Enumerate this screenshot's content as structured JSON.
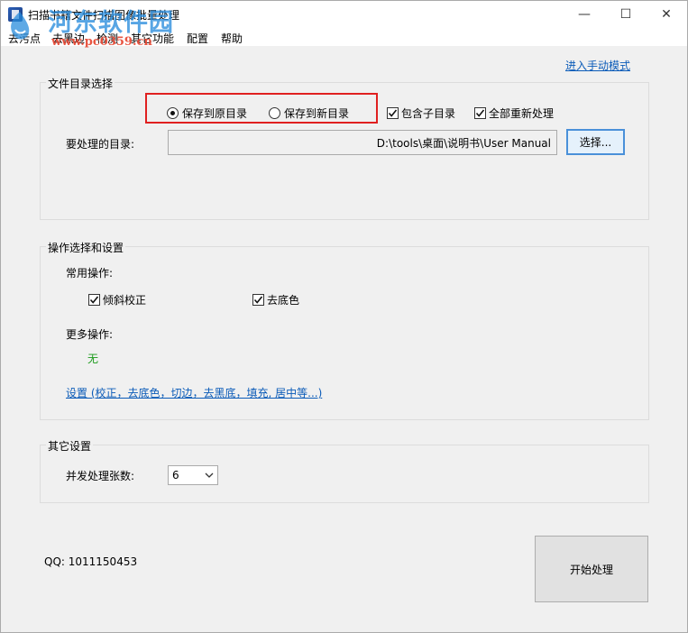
{
  "window": {
    "title": "扫描书籍文件扫描图像批量处理",
    "controls": {
      "minimize": "—",
      "maximize": "☐",
      "close": "✕"
    }
  },
  "watermark": {
    "site_name": "河东软件园",
    "url": "www.pc0359.cn"
  },
  "menu": {
    "items": [
      "去污点",
      "去黑边",
      "检测",
      "其它功能",
      "配置",
      "帮助"
    ]
  },
  "manual_mode_link": "进入手动模式",
  "file_group": {
    "title": "文件目录选择",
    "radio_original": "保存到原目录",
    "radio_new": "保存到新目录",
    "selected": "original",
    "include_subdirs": {
      "label": "包含子目录",
      "checked": true
    },
    "reprocess_all": {
      "label": "全部重新处理",
      "checked": true
    },
    "dir_label": "要处理的目录:",
    "dir_value": "D:\\tools\\桌面\\说明书\\User Manual",
    "browse_button": "选择..."
  },
  "ops_group": {
    "title": "操作选择和设置",
    "common_label": "常用操作:",
    "deskew": {
      "label": "倾斜校正",
      "checked": true
    },
    "remove_bg": {
      "label": "去底色",
      "checked": true
    },
    "more_label": "更多操作:",
    "more_value": "无",
    "settings_link": "设置 (校正，去底色，切边，去黑底，填充, 居中等...)"
  },
  "other_group": {
    "title": "其它设置",
    "concurrency_label": "并发处理张数:",
    "concurrency_value": "6"
  },
  "qq": "QQ: 1011150453",
  "start_button": "开始处理",
  "colors": {
    "window_bg": "#f0f0f0",
    "link": "#0b5bb8",
    "highlight": "#e02020",
    "none_text": "#1a9a1a"
  }
}
